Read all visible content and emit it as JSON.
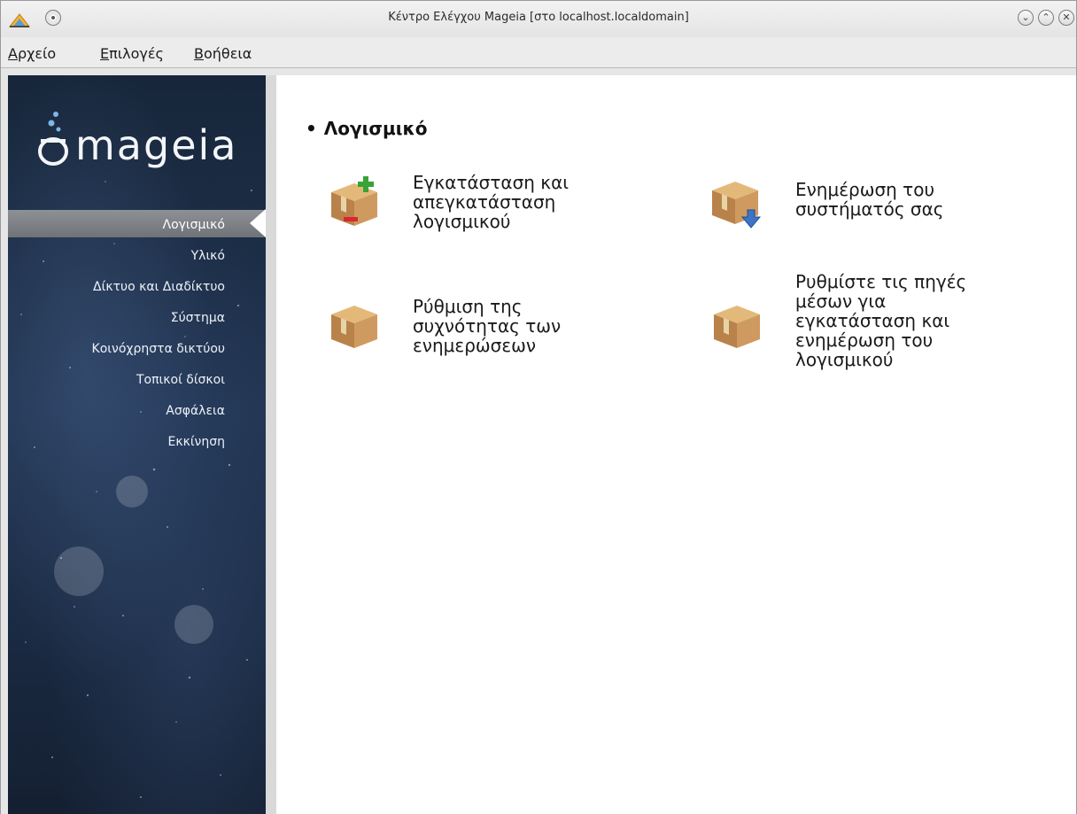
{
  "window": {
    "title": "Κέντρο Ελέγχου Mageia  [στο localhost.localdomain]",
    "buttons": [
      "minimize",
      "maximize",
      "close"
    ]
  },
  "menu": {
    "items": [
      {
        "accel": "Α",
        "rest": "ρχείο"
      },
      {
        "accel": "Ε",
        "rest": "πιλογές"
      },
      {
        "accel": "Β",
        "rest": "οήθεια"
      }
    ]
  },
  "sidebar": {
    "brand": "mageia",
    "items": [
      {
        "label": "Λογισμικό",
        "active": true
      },
      {
        "label": "Υλικό"
      },
      {
        "label": "Δίκτυο και Διαδίκτυο"
      },
      {
        "label": "Σύστημα"
      },
      {
        "label": "Κοινόχρηστα δικτύου"
      },
      {
        "label": "Τοπικοί δίσκοι"
      },
      {
        "label": "Ασφάλεια"
      },
      {
        "label": "Εκκίνηση"
      }
    ]
  },
  "main": {
    "section_title": "Λογισμικό",
    "tiles": [
      {
        "label": "Εγκατάσταση και\nαπεγκατάσταση\nλογισμικού",
        "icon": "package-add-remove-icon"
      },
      {
        "label": "Ενημέρωση του\nσυστήματός σας",
        "icon": "package-update-icon"
      },
      {
        "label": "Ρύθμιση της\nσυχνότητας των\nενημερώσεων",
        "icon": "package-icon"
      },
      {
        "label": "Ρυθμίστε τις πηγές\nμέσων για\nεγκατάσταση και\nενημέρωση του\nλογισμικού",
        "icon": "package-icon"
      }
    ]
  },
  "colors": {
    "sidebar_bg": "#1c2c44",
    "accent": "#7fb6e6"
  }
}
